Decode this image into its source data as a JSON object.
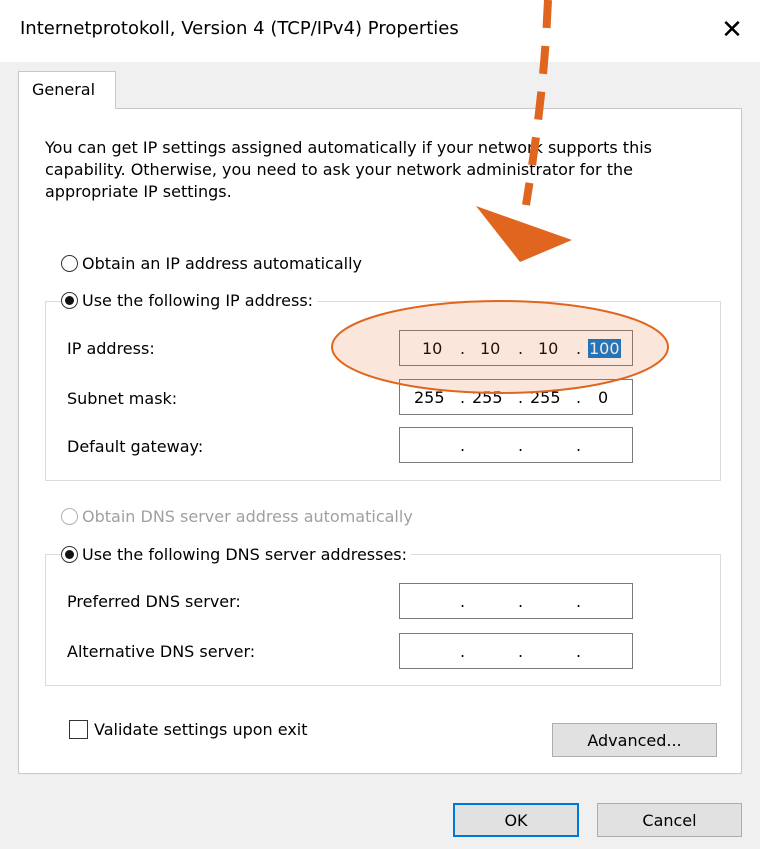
{
  "window": {
    "title": "Internetprotokoll, Version 4 (TCP/IPv4) Properties",
    "close_glyph": "✕"
  },
  "tabs": [
    {
      "label": "General"
    }
  ],
  "intro_text": "You can get IP settings assigned automatically if your network supports this capability. Otherwise, you need to ask your network administrator for the appropriate IP settings.",
  "ip_section": {
    "auto_label": "Obtain an IP address automatically",
    "auto_selected": false,
    "manual_label": "Use the following IP address:",
    "manual_selected": true,
    "fields": {
      "ip_address": {
        "label": "IP address:",
        "octets": [
          "10",
          "10",
          "10",
          "100"
        ]
      },
      "subnet_mask": {
        "label": "Subnet mask:",
        "octets": [
          "255",
          "255",
          "255",
          "0"
        ]
      },
      "default_gateway": {
        "label": "Default gateway:",
        "octets": [
          "",
          "",
          "",
          ""
        ]
      }
    }
  },
  "dns_section": {
    "auto_label": "Obtain DNS server address automatically",
    "auto_enabled": false,
    "manual_label": "Use the following DNS server addresses:",
    "manual_selected": true,
    "fields": {
      "preferred": {
        "label": "Preferred DNS server:",
        "octets": [
          "",
          "",
          "",
          ""
        ]
      },
      "alternative": {
        "label": "Alternative DNS server:",
        "octets": [
          "",
          "",
          "",
          ""
        ]
      }
    }
  },
  "validate": {
    "label": "Validate settings upon exit",
    "checked": false
  },
  "buttons": {
    "advanced": "Advanced...",
    "ok": "OK",
    "cancel": "Cancel"
  },
  "ip_separator": ".",
  "annotation": {
    "color": "#e0661f",
    "arrow_style": "dashed"
  }
}
